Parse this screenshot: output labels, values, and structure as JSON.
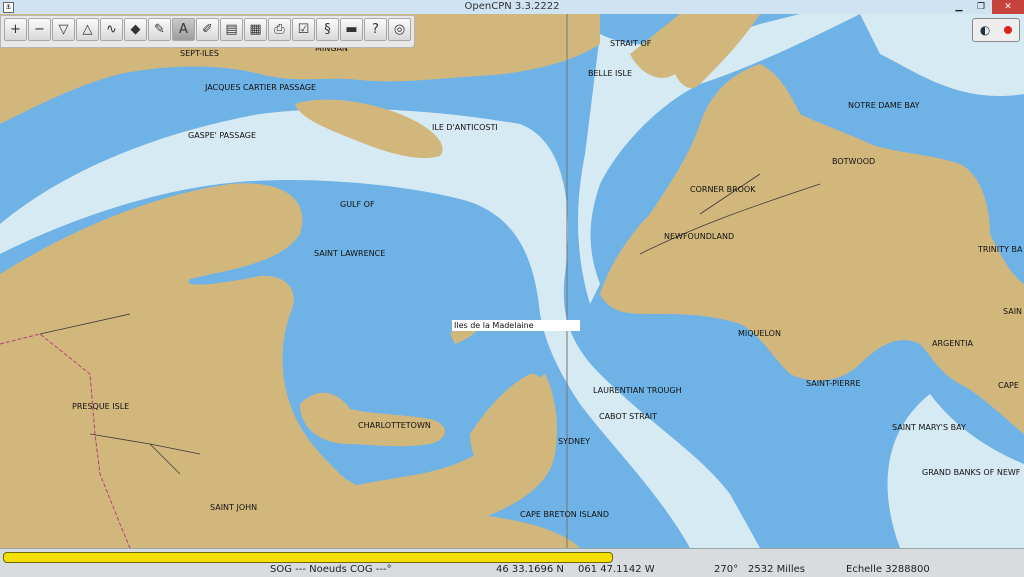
{
  "window": {
    "title": "OpenCPN 3.3.2222",
    "icon_text": "⚓"
  },
  "toolbar": {
    "buttons": [
      {
        "name": "zoom-in-button",
        "icon": "zoom-in-icon",
        "glyph": "+"
      },
      {
        "name": "zoom-out-button",
        "icon": "zoom-out-icon",
        "glyph": "−"
      },
      {
        "name": "scale-in-button",
        "icon": "funnel-icon",
        "glyph": "▽"
      },
      {
        "name": "scale-out-button",
        "icon": "cone-icon",
        "glyph": "△"
      },
      {
        "name": "route-button",
        "icon": "route-icon",
        "glyph": "∿"
      },
      {
        "name": "follow-ship-button",
        "icon": "ship-icon",
        "glyph": "◆"
      },
      {
        "name": "settings-button",
        "icon": "wrench-icon",
        "glyph": "✎"
      },
      {
        "name": "text-button",
        "icon": "text-a-icon",
        "glyph": "A"
      },
      {
        "name": "current-button",
        "icon": "pencil-icon",
        "glyph": "✐"
      },
      {
        "name": "tide-button",
        "icon": "tide-icon",
        "glyph": "▤"
      },
      {
        "name": "chart-button",
        "icon": "chart-icon",
        "glyph": "▦"
      },
      {
        "name": "print-button",
        "icon": "printer-icon",
        "glyph": "⎙"
      },
      {
        "name": "route-manager-button",
        "icon": "checklist-icon",
        "glyph": "☑"
      },
      {
        "name": "track-button",
        "icon": "track-icon",
        "glyph": "§"
      },
      {
        "name": "color-scheme-button",
        "icon": "brightness-icon",
        "glyph": "▬"
      },
      {
        "name": "help-button",
        "icon": "help-icon",
        "glyph": "?"
      },
      {
        "name": "mob-button",
        "icon": "lifebuoy-icon",
        "glyph": "◎"
      }
    ],
    "active_index": 7
  },
  "map_labels": [
    {
      "text": "SEPT-ILES"
    },
    {
      "text": "MINGAN"
    },
    {
      "text": "STRAIT OF"
    },
    {
      "text": "BELLE ISLE"
    },
    {
      "text": "JACQUES CARTIER PASSAGE"
    },
    {
      "text": "ILE D'ANTICOSTI"
    },
    {
      "text": "GASPE' PASSAGE"
    },
    {
      "text": "NOTRE DAME BAY"
    },
    {
      "text": "BOTWOOD"
    },
    {
      "text": "CORNER BROOK"
    },
    {
      "text": "GULF OF"
    },
    {
      "text": "NEWFOUNDLAND"
    },
    {
      "text": "TRINITY BA"
    },
    {
      "text": "SAINT LAWRENCE"
    },
    {
      "text": "Iles de la Madelaine"
    },
    {
      "text": "MIQUELON"
    },
    {
      "text": "SAIN"
    },
    {
      "text": "ARGENTIA"
    },
    {
      "text": "PRESQUE ISLE"
    },
    {
      "text": "LAURENTIAN TROUGH"
    },
    {
      "text": "SAINT-PIERRE"
    },
    {
      "text": "CAPE"
    },
    {
      "text": "CABOT STRAIT"
    },
    {
      "text": "CHARLOTTETOWN"
    },
    {
      "text": "SAINT MARY'S BAY"
    },
    {
      "text": "SYDNEY"
    },
    {
      "text": "GRAND BANKS OF NEWF"
    },
    {
      "text": "SAINT JOHN"
    },
    {
      "text": "CAPE BRETON ISLAND"
    }
  ],
  "colors": {
    "land": "#d2b77d",
    "shallow": "#6fb2e6",
    "deep": "#d6eaf3",
    "border": "#b4417a",
    "road": "#3a3a3a"
  },
  "status": {
    "progress": 1.0,
    "sog_cog": "SOG --- Noeuds COG ---°",
    "latitude": "46 33.1696 N",
    "longitude": "061 47.1142 W",
    "bearing": "270°",
    "distance": "2532 Milles",
    "scale": "Echelle 3288800"
  }
}
